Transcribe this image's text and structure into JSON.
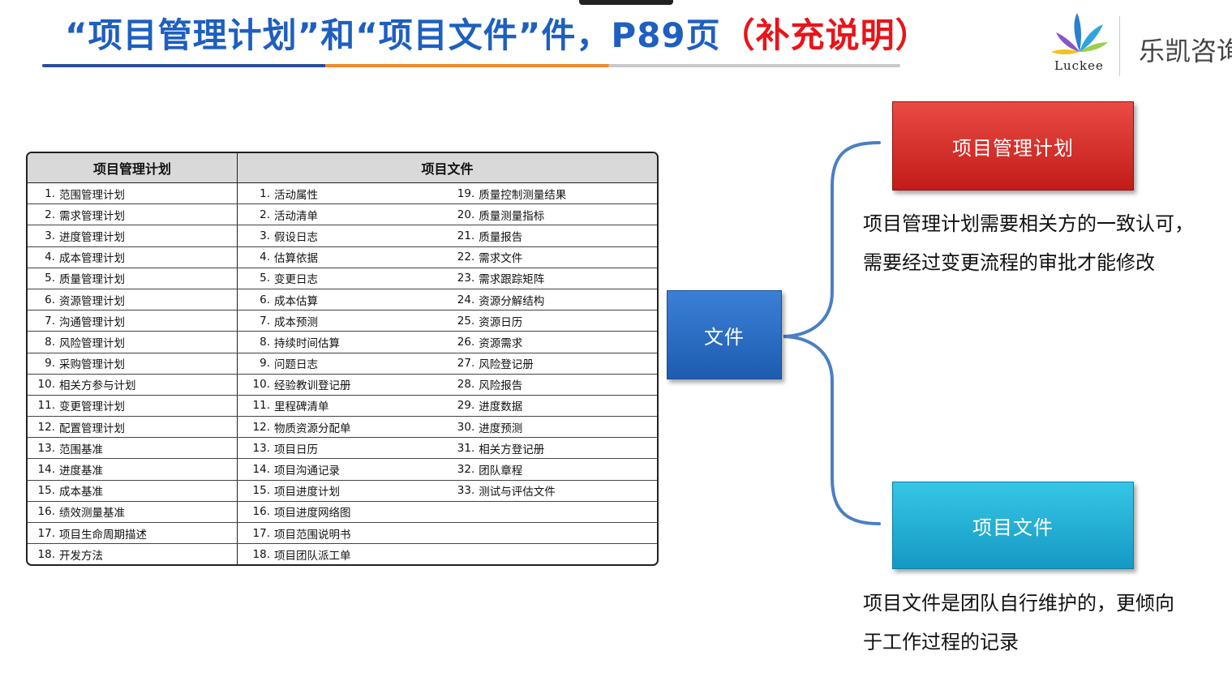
{
  "slide": {
    "title_part1": "“项目管理计划”和“项目文件”件，P89页",
    "title_part2": "（补充说明）",
    "title_blue": "#1e5fbf",
    "title_red": "#e8141a"
  },
  "logo": {
    "word": "Luckee",
    "company": "乐凯咨询",
    "icon": "luckee-flower-logo"
  },
  "table": {
    "header_plan": "项目管理计划",
    "header_docs": "项目文件",
    "rows": [
      {
        "a": "1. 范围管理计划",
        "b": "1. 活动属性",
        "c": "19. 质量控制测量结果"
      },
      {
        "a": "2. 需求管理计划",
        "b": "2. 活动清单",
        "c": "20. 质量测量指标"
      },
      {
        "a": "3. 进度管理计划",
        "b": "3. 假设日志",
        "c": "21. 质量报告"
      },
      {
        "a": "4. 成本管理计划",
        "b": "4. 估算依据",
        "c": "22. 需求文件"
      },
      {
        "a": "5. 质量管理计划",
        "b": "5. 变更日志",
        "c": "23. 需求跟踪矩阵"
      },
      {
        "a": "6. 资源管理计划",
        "b": "6. 成本估算",
        "c": "24. 资源分解结构"
      },
      {
        "a": "7. 沟通管理计划",
        "b": "7. 成本预测",
        "c": "25. 资源日历"
      },
      {
        "a": "8. 风险管理计划",
        "b": "8. 持续时间估算",
        "c": "26. 资源需求"
      },
      {
        "a": "9. 采购管理计划",
        "b": "9. 问题日志",
        "c": "27. 风险登记册"
      },
      {
        "a": "10. 相关方参与计划",
        "b": "10. 经验教训登记册",
        "c": "28. 风险报告"
      },
      {
        "a": "11. 变更管理计划",
        "b": "11. 里程碑清单",
        "c": "29. 进度数据"
      },
      {
        "a": "12. 配置管理计划",
        "b": "12. 物质资源分配单",
        "c": "30. 进度预测"
      },
      {
        "a": "13. 范围基准",
        "b": "13. 项目日历",
        "c": "31. 相关方登记册"
      },
      {
        "a": "14. 进度基准",
        "b": "14. 项目沟通记录",
        "c": "32. 团队章程"
      },
      {
        "a": "15. 成本基准",
        "b": "15. 项目进度计划",
        "c": "33. 测试与评估文件"
      },
      {
        "a": "16. 绩效测量基准",
        "b": "16. 项目进度网络图",
        "c": ""
      },
      {
        "a": "17. 项目生命周期描述",
        "b": "17. 项目范围说明书",
        "c": ""
      },
      {
        "a": "18. 开发方法",
        "b": "18. 项目团队派工单",
        "c": ""
      }
    ]
  },
  "diagram": {
    "root_label": "文件",
    "plan_label": "项目管理计划",
    "docs_label": "项目文件",
    "plan_desc_line1": "项目管理计划需要相关方的一致认可，",
    "plan_desc_line2": "需要经过变更流程的审批才能修改",
    "docs_desc_line1": "项目文件是团队自行维护的，更倾向",
    "docs_desc_line2": "于工作过程的记录",
    "root_color": "#1d5cb0",
    "plan_color": "#c21c19",
    "docs_color": "#1599c4",
    "bracket_color": "#4a7fc4"
  }
}
